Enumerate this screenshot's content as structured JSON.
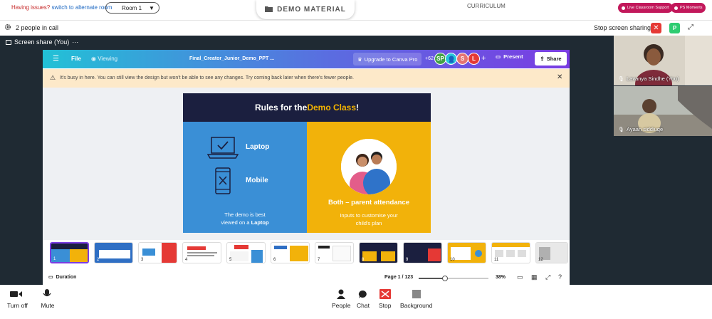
{
  "topbar": {
    "issues_text": "Having issues?",
    "alternate_room_link": "switch to alternate room",
    "room_select": "Room 1",
    "demo_tab_label": "DEMO MATERIAL",
    "curriculum_label": "CURRICULUM",
    "live_support_label": "Live Classroom Support",
    "ps_moments_label": "PS Moments"
  },
  "callbar": {
    "people_text": "2 people in call",
    "stop_sharing_label": "Stop screen sharing",
    "participant_initial": "P"
  },
  "share": {
    "label": "Screen share (You)",
    "more": "···"
  },
  "canva": {
    "file_label": "File",
    "viewing_label": "Viewing",
    "doc_title": "Final_Creator_Junior_Demo_PPT ...",
    "upgrade_label": "Upgrade to Canva Pro",
    "collab_count": "+62",
    "avatars": [
      "SP",
      "",
      "S",
      "L"
    ],
    "plus_label": "+",
    "present_label": "Present",
    "share_label": "Share",
    "warning_text": "It's busy in here. You can still view the design but won't be able to see any changes. Try coming back later when there's fewer people.",
    "slide": {
      "title_prefix": "Rules for the ",
      "title_highlight": "Demo Class",
      "title_suffix": "!",
      "laptop_label": "Laptop",
      "mobile_label": "Mobile",
      "demo_note_line1": "The demo is best",
      "demo_note_line2_prefix": "viewed on a ",
      "demo_note_line2_bold": "Laptop",
      "both_label": "Both – parent attendance",
      "inputs_line1": "Inputs to customise your",
      "inputs_line2": "child's plan"
    },
    "thumbnails": [
      "1",
      "2",
      "3",
      "4",
      "5",
      "6",
      "7",
      "8",
      "9",
      "10",
      "11",
      "12"
    ],
    "duration_label": "Duration",
    "page_info": "Page 1 / 123",
    "zoom_fraction": 0.38,
    "zoom_label": "38%"
  },
  "participants": [
    {
      "name": "Lavanya Sindhe (You)"
    },
    {
      "name": "Ayaan siddiuqe"
    }
  ],
  "bottombar": {
    "turn_off_label": "Turn off",
    "mute_label": "Mute",
    "people_label": "People",
    "chat_label": "Chat",
    "stop_label": "Stop",
    "background_label": "Background"
  },
  "colors": {
    "accent_red": "#e53935",
    "canva_purple": "#7a3ce2",
    "slide_navy": "#1b1f3f",
    "slide_blue": "#3a8fd6",
    "slide_yellow": "#f2b20a"
  }
}
